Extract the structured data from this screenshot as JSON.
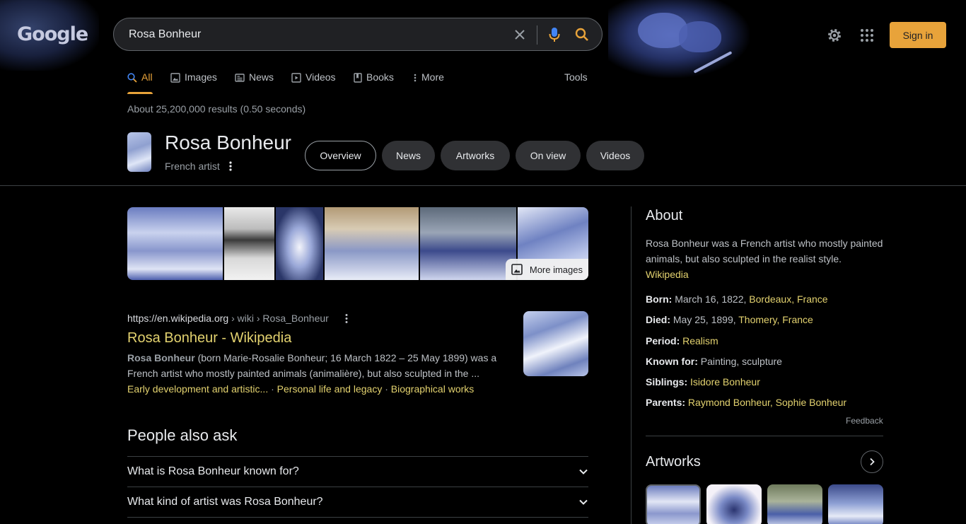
{
  "header": {
    "logo_text": "Google",
    "search_query": "Rosa Bonheur",
    "signin_label": "Sign in"
  },
  "tabs": [
    {
      "label": "All",
      "icon": "search-icon",
      "active": true
    },
    {
      "label": "Images",
      "icon": "image-icon"
    },
    {
      "label": "News",
      "icon": "news-icon"
    },
    {
      "label": "Videos",
      "icon": "video-icon"
    },
    {
      "label": "Books",
      "icon": "book-icon"
    },
    {
      "label": "More",
      "icon": "more-vert-icon"
    }
  ],
  "tools_label": "Tools",
  "result_stats": "About 25,200,000 results (0.50 seconds)",
  "entity": {
    "title": "Rosa Bonheur",
    "subtitle": "French artist",
    "chips": [
      "Overview",
      "News",
      "Artworks",
      "On view",
      "Videos"
    ]
  },
  "images_strip": {
    "more_label": "More images"
  },
  "result": {
    "url": "https://en.wikipedia.org",
    "crumb": " › wiki › Rosa_Bonheur",
    "title": "Rosa Bonheur - Wikipedia",
    "snippet_bold": "Rosa Bonheur",
    "snippet_rest": " (born Marie-Rosalie Bonheur; 16 March 1822 – 25 May 1899) was a French artist who mostly painted animals (animalière), but also sculpted in the ...",
    "links": [
      "Early development and artistic...",
      "Personal life and legacy",
      "Biographical works"
    ],
    "link_sep": " · "
  },
  "people_also_ask": {
    "title": "People also ask",
    "questions": [
      "What is Rosa Bonheur known for?",
      "What kind of artist was Rosa Bonheur?"
    ]
  },
  "knowledge_panel": {
    "about_title": "About",
    "description": "Rosa Bonheur was a French artist who mostly painted animals, but also sculpted in the realist style.",
    "source": "Wikipedia",
    "facts": [
      {
        "label": "Born:",
        "text": " March 16, 1822, ",
        "link": "Bordeaux, France"
      },
      {
        "label": "Died:",
        "text": " May 25, 1899, ",
        "link": "Thomery, France"
      },
      {
        "label": "Period:",
        "text": " ",
        "link": "Realism"
      },
      {
        "label": "Known for:",
        "text": " Painting, sculpture",
        "link": ""
      },
      {
        "label": "Siblings:",
        "text": " ",
        "link": "Isidore Bonheur"
      },
      {
        "label": "Parents:",
        "text": " ",
        "link": "Raymond Bonheur, Sophie Bonheur"
      }
    ],
    "feedback_label": "Feedback",
    "artworks_title": "Artworks"
  },
  "colors": {
    "accent": "#e8a33a",
    "link": "#e3d26f",
    "background": "#000000"
  }
}
